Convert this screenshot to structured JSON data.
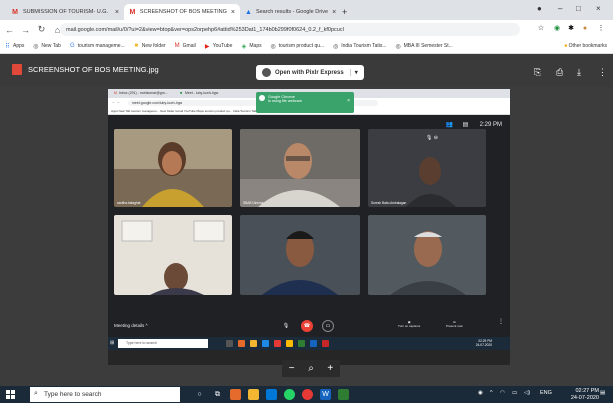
{
  "tabs": [
    {
      "label": "SUBMISSION OF TOURISM- U.G.",
      "icon": "gmail-icon",
      "active": false
    },
    {
      "label": "SCREENSHOT OF BOS MEETING",
      "icon": "gmail-icon",
      "active": true
    },
    {
      "label": "Search results - Google Drive",
      "icon": "drive-icon",
      "active": false
    }
  ],
  "url": "mail.google.com/mail/u/0/?ui=2&view=btop&ver=ops2orpehp6#attid%253Dat1_174b0b299f0f0624_0.2_f_kf0pcucl",
  "bookmarks": [
    "Apps",
    "New Tab",
    "tourism manageme...",
    "New folder",
    "Gmail",
    "YouTube",
    "Maps",
    "tourism product qu...",
    "India Tourism Tatis...",
    "MBA III Semester St..."
  ],
  "bookmarks_right": "Other bookmarks",
  "viewer": {
    "filename": "SCREENSHOT OF BOS MEETING.jpg",
    "open_with": "Open with Pixlr Express"
  },
  "shot": {
    "tabs": [
      "Inbox (291) - mohkumar@gm...",
      "Meet - iuby-iuwh-hgw"
    ],
    "url": "meet.google.com/iuby-iuwh-hgw",
    "bookmarks": "Apps  New Tab  tourism manageme...  New folder  Gmail  YouTube  Maps  tourism product qu...  India Tourism Tatis...  MBA III Semester St...",
    "popup_title": "Google Chrome",
    "popup_text": "is using file webcam",
    "time": "2:29 PM",
    "participants": [
      {
        "name": "savitha.bataghat",
        "bg": "#7a6a55"
      },
      {
        "name": "SBAB Director",
        "bg": "#8a8580"
      },
      {
        "name": "Suresh Babu Ambalagan",
        "bg": "#3b3d42"
      },
      {
        "name": "",
        "bg": "#6a7a80"
      },
      {
        "name": "",
        "bg": "#4a5058"
      },
      {
        "name": "",
        "bg": "#525a60"
      }
    ],
    "meeting_details": "Meeting details",
    "turn_on_captions": "Turn on captions",
    "present_now": "Present now",
    "taskbar_search": "Type here to search",
    "taskbar_time": "02:29 PM",
    "taskbar_date": "24-07-2020"
  },
  "taskbar": {
    "search": "Type here to search",
    "lang": "ENG",
    "time": "02:27 PM",
    "date": "24-07-2020"
  }
}
